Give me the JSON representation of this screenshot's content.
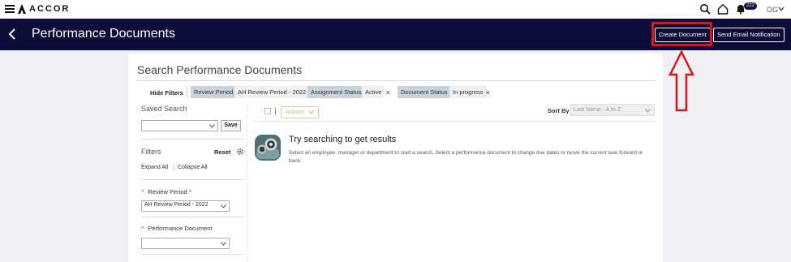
{
  "brand": {
    "name": "ACCOR"
  },
  "topbar": {
    "notification_count": "222",
    "user_initials": "OG"
  },
  "nav": {
    "title": "Performance Documents",
    "create_button": "Create Document",
    "email_button": "Send Email Notification"
  },
  "annotation": {
    "color": "#e0131a"
  },
  "search": {
    "title": "Search Performance Documents",
    "hide_filters": "Hide Filters",
    "chips": [
      {
        "label": "Review Period",
        "value": "AH Review Period - 2022"
      },
      {
        "label": "Assignment Status",
        "value": "Active"
      },
      {
        "label": "Document Status",
        "value": "In progress"
      }
    ]
  },
  "sidebar": {
    "saved_search_label": "Saved Search",
    "saved_search_value": "",
    "save_button": "Save",
    "filters_label": "Filters",
    "reset": "Reset",
    "expand_all": "Expand All",
    "collapse_all": "Collapse All",
    "sections": [
      {
        "label": "Review Period *",
        "value": "AH Review Period - 2022"
      },
      {
        "label": "Performance Document",
        "value": ""
      }
    ]
  },
  "results": {
    "actions_label": "Actions",
    "sort_by_label": "Sort By",
    "sort_value": "Last Name - A to Z",
    "empty_title": "Try searching to get results",
    "empty_text": "Select an employee, manager or department to start a search. Select a performance document to change due dates or move the current task forward or back."
  },
  "icons": [
    "hamburger-icon",
    "accor-logo-icon",
    "search-icon",
    "home-icon",
    "bell-icon",
    "chevron-down-icon",
    "back-arrow-icon",
    "close-icon",
    "gear-icon",
    "binoculars-icon"
  ]
}
